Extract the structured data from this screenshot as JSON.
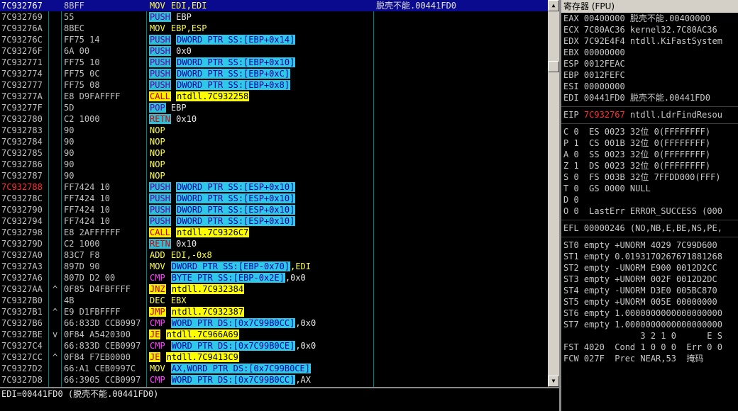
{
  "disasm": {
    "rows": [
      {
        "addr": "7C932767",
        "mark": "",
        "hex": "8BFF",
        "m": "MOV",
        "op": "EDI,EDI",
        "cmt": "脱壳不能.00441FD0",
        "sel": true
      },
      {
        "addr": "7C932769",
        "mark": "",
        "hex": "55",
        "m": "PUSH",
        "op": "EBP"
      },
      {
        "addr": "7C93276A",
        "mark": "",
        "hex": "8BEC",
        "m": "MOV",
        "op": "EBP,ESP"
      },
      {
        "addr": "7C93276C",
        "mark": "",
        "hex": "FF75 14",
        "m": "PUSH",
        "op": "DWORD PTR SS:[EBP+0x14]"
      },
      {
        "addr": "7C93276F",
        "mark": "",
        "hex": "6A 00",
        "m": "PUSH",
        "op": "0x0"
      },
      {
        "addr": "7C932771",
        "mark": "",
        "hex": "FF75 10",
        "m": "PUSH",
        "op": "DWORD PTR SS:[EBP+0x10]"
      },
      {
        "addr": "7C932774",
        "mark": "",
        "hex": "FF75 0C",
        "m": "PUSH",
        "op": "DWORD PTR SS:[EBP+0xC]"
      },
      {
        "addr": "7C932777",
        "mark": "",
        "hex": "FF75 08",
        "m": "PUSH",
        "op": "DWORD PTR SS:[EBP+0x8]"
      },
      {
        "addr": "7C93277A",
        "mark": "",
        "hex": "E8 D9FAFFFF",
        "m": "CALL",
        "op": "ntdll.7C932258"
      },
      {
        "addr": "7C93277F",
        "mark": "",
        "hex": "5D",
        "m": "POP",
        "op": "EBP"
      },
      {
        "addr": "7C932780",
        "mark": "",
        "hex": "C2 1000",
        "m": "RETN",
        "op": "0x10"
      },
      {
        "addr": "7C932783",
        "mark": "",
        "hex": "90",
        "m": "NOP",
        "op": ""
      },
      {
        "addr": "7C932784",
        "mark": "",
        "hex": "90",
        "m": "NOP",
        "op": ""
      },
      {
        "addr": "7C932785",
        "mark": "",
        "hex": "90",
        "m": "NOP",
        "op": ""
      },
      {
        "addr": "7C932786",
        "mark": "",
        "hex": "90",
        "m": "NOP",
        "op": ""
      },
      {
        "addr": "7C932787",
        "mark": "",
        "hex": "90",
        "m": "NOP",
        "op": ""
      },
      {
        "addr": "7C932788",
        "mark": "",
        "hex": "FF7424 10",
        "m": "PUSH",
        "op": "DWORD PTR SS:[ESP+0x10]",
        "bp": true
      },
      {
        "addr": "7C93278C",
        "mark": "",
        "hex": "FF7424 10",
        "m": "PUSH",
        "op": "DWORD PTR SS:[ESP+0x10]"
      },
      {
        "addr": "7C932790",
        "mark": "",
        "hex": "FF7424 10",
        "m": "PUSH",
        "op": "DWORD PTR SS:[ESP+0x10]"
      },
      {
        "addr": "7C932794",
        "mark": "",
        "hex": "FF7424 10",
        "m": "PUSH",
        "op": "DWORD PTR SS:[ESP+0x10]"
      },
      {
        "addr": "7C932798",
        "mark": "",
        "hex": "E8 2AFFFFFF",
        "m": "CALL",
        "op": "ntdll.7C9326C7"
      },
      {
        "addr": "7C93279D",
        "mark": "",
        "hex": "C2 1000",
        "m": "RETN",
        "op": "0x10"
      },
      {
        "addr": "7C9327A0",
        "mark": "",
        "hex": "83C7 F8",
        "m": "ADD",
        "op": "EDI,-0x8"
      },
      {
        "addr": "7C9327A3",
        "mark": "",
        "hex": "897D 90",
        "m": "MOV",
        "op": "DWORD PTR SS:[EBP-0x70]",
        "op2": ",EDI"
      },
      {
        "addr": "7C9327A6",
        "mark": "",
        "hex": "807D D2 00",
        "m": "CMP",
        "op": "BYTE PTR SS:[EBP-0x2E]",
        "op2": ",0x0"
      },
      {
        "addr": "7C9327AA",
        "mark": "^",
        "hex": "0F85 D4FBFFFF",
        "m": "JNZ",
        "op": "ntdll.7C932384"
      },
      {
        "addr": "7C9327B0",
        "mark": "",
        "hex": "4B",
        "m": "DEC",
        "op": "EBX"
      },
      {
        "addr": "7C9327B1",
        "mark": "^",
        "hex": "E9 D1FBFFFF",
        "m": "JMP",
        "op": "ntdll.7C932387"
      },
      {
        "addr": "7C9327B6",
        "mark": "",
        "hex": "66:833D CCB0997",
        "m": "CMP",
        "op": "WORD PTR DS:[0x7C99B0CC]",
        "op2": ",0x0"
      },
      {
        "addr": "7C9327BE",
        "mark": "v",
        "hex": "0F84 A5420300",
        "m": "JE",
        "op": "ntdll.7C966A69"
      },
      {
        "addr": "7C9327C4",
        "mark": "",
        "hex": "66:833D CEB0997",
        "m": "CMP",
        "op": "WORD PTR DS:[0x7C99B0CE]",
        "op2": ",0x0"
      },
      {
        "addr": "7C9327CC",
        "mark": "^",
        "hex": "0F84 F7EB0000",
        "m": "JE",
        "op": "ntdll.7C9413C9"
      },
      {
        "addr": "7C9327D2",
        "mark": "",
        "hex": "66:A1 CEB0997C",
        "m": "MOV",
        "op": "AX,WORD PTR DS:[0x7C99B0CE]"
      },
      {
        "addr": "7C9327D8",
        "mark": "",
        "hex": "66:3905 CCB0997",
        "m": "CMP",
        "op": "WORD PTR DS:[0x7C99B0CC]",
        "op2": ",AX"
      }
    ]
  },
  "status": {
    "text": "EDI=00441FD0 (脱壳不能.00441FD0)"
  },
  "registers": {
    "header": "寄存器 (FPU)",
    "lines": [
      "EAX 00400000 脱壳不能.00400000",
      "ECX 7C80AC36 kernel32.7C80AC36",
      "EDX 7C92E4F4 ntdll.KiFastSystem",
      "EBX 00000000",
      "ESP 0012FEAC",
      "EBP 0012FEFC",
      "ESI 00000000",
      "EDI 00441FD0 脱壳不能.00441FD0"
    ],
    "eip_label": "EIP",
    "eip_value": "7C932767",
    "eip_rest": "ntdll.LdrFindResou",
    "flags": [
      "C 0  ES 0023 32位 0(FFFFFFFF)",
      "P 1  CS 001B 32位 0(FFFFFFFF)",
      "A 0  SS 0023 32位 0(FFFFFFFF)",
      "Z 1  DS 0023 32位 0(FFFFFFFF)",
      "S 0  FS 003B 32位 7FFDD000(FFF)",
      "T 0  GS 0000 NULL",
      "D 0",
      "O 0  LastErr ERROR_SUCCESS (000"
    ],
    "efl": "EFL 00000246 (NO,NB,E,BE,NS,PE,",
    "fpu": [
      "ST0 empty +UNORM 4029 7C99D600",
      "ST1 empty 0.0193170267671881268",
      "ST2 empty -UNORM E900 0012D2CC",
      "ST3 empty +UNORM 002F 0012D2DC",
      "ST4 empty -UNORM D3E0 005BC870",
      "ST5 empty +UNORM 005E 00000000",
      "ST6 empty 1.0000000000000000000",
      "ST7 empty 1.0000000000000000000"
    ],
    "fpu_hdr": "               3 2 1 0      E S",
    "fst": "FST 4020  Cond 1 0 0 0  Err 0 0",
    "fcw": "FCW 027F  Prec NEAR,53  掩码"
  }
}
